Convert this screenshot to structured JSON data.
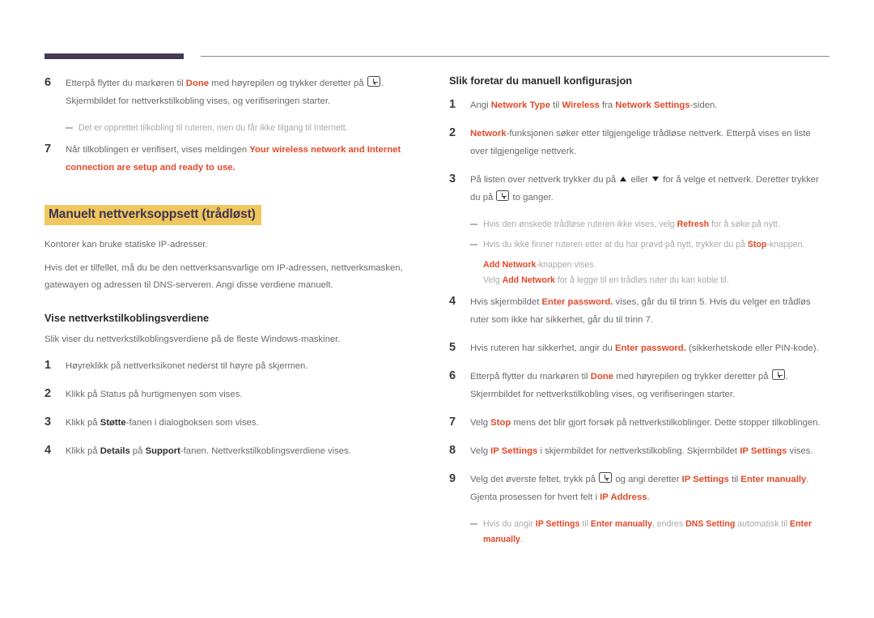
{
  "colors": {
    "accent_red": "#e2492a",
    "highlight_yellow": "#efc75e",
    "heading_purple": "#3f3354",
    "rule_purple": "#453a55",
    "body_gray": "#6a6a6a",
    "note_gray": "#a9a9a9"
  },
  "left_column": {
    "step6": {
      "num": "6",
      "t1": "Etterpå flytter du markøren til ",
      "a1": "Done",
      "t2": " med høyrepilen og trykker deretter på ",
      "t3": ". Skjermbildet for nettverkstilkobling vises, og verifiseringen starter."
    },
    "note6": "Det er opprettet tilkobling til ruteren, men du får ikke tilgang til Internett.",
    "step7": {
      "num": "7",
      "t1": "Når tilkoblingen er verifisert, vises meldingen ",
      "a1": "Your wireless network and Internet connection are setup and ready to use."
    },
    "heading_manual": "Manuelt nettverksoppsett (trådløst)",
    "para1": "Kontorer kan bruke statiske IP-adresser.",
    "para2": "Hvis det er tilfellet, må du be den nettverksansvarlige om IP-adressen, nettverksmasken, gatewayen og adressen til DNS-serveren. Angi disse verdiene manuelt.",
    "heading_view": "Vise nettverkstilkoblingsverdiene",
    "para3": "Slik viser du nettverkstilkoblingsverdiene på de fleste Windows-maskiner.",
    "steps": [
      {
        "num": "1",
        "t1": "Høyreklikk på nettverksikonet nederst til høyre på skjermen."
      },
      {
        "num": "2",
        "t1": "Klikk på Status på hurtigmenyen som vises."
      },
      {
        "num": "3",
        "t1": "Klikk på ",
        "b1": "Støtte",
        "t2": "-fanen i dialogboksen som vises."
      },
      {
        "num": "4",
        "t1": "Klikk på ",
        "b1": "Details",
        "t2": " på ",
        "b2": "Support",
        "t3": "-fanen. Nettverkstilkoblingsverdiene vises."
      }
    ]
  },
  "right_column": {
    "heading": "Slik foretar du manuell konfigurasjon",
    "step1": {
      "num": "1",
      "t1": "Angi ",
      "a1": "Network Type",
      "t2": " til ",
      "a2": "Wireless",
      "t3": " fra ",
      "a3": "Network Settings",
      "t4": "-siden."
    },
    "step2": {
      "num": "2",
      "a1": "Network",
      "t1": "-funksjonen søker etter tilgjengelige trådløse nettverk. Etterpå vises en liste over tilgjengelige nettverk."
    },
    "step3": {
      "num": "3",
      "t1": "På listen over nettverk trykker du på ",
      "t2": " eller ",
      "t3": " for å velge et nettverk. Deretter trykker du på ",
      "t4": " to ganger."
    },
    "note3a": {
      "t1": "Hvis den ønskede trådløse ruteren ikke vises, velg ",
      "a1": "Refresh",
      "t2": " for å søke på nytt."
    },
    "note3b": {
      "t1": "Hvis du ikke finner ruteren etter at du har prøvd på nytt, trykker du på ",
      "a1": "Stop",
      "t2": "-knappen.",
      "a2": "Add Network",
      "t3": "-knappen vises.",
      "t4": "Velg ",
      "a3": "Add Network",
      "t5": " for å legge til en trådløs ruter du kan koble til."
    },
    "step4": {
      "num": "4",
      "t1": "Hvis skjermbildet ",
      "a1": "Enter password.",
      "t2": " vises, går du til trinn 5. Hvis du velger en trådløs ruter som ikke har sikkerhet, går du til trinn 7."
    },
    "step5": {
      "num": "5",
      "t1": "Hvis ruteren har sikkerhet, angir du ",
      "a1": "Enter password.",
      "t2": " (sikkerhetskode eller PIN-kode)."
    },
    "step6": {
      "num": "6",
      "t1": "Etterpå flytter du markøren til ",
      "a1": "Done",
      "t2": " med høyrepilen og trykker deretter på ",
      "t3": ". Skjermbildet for nettverkstilkobling vises, og verifiseringen starter."
    },
    "step7": {
      "num": "7",
      "t1": "Velg ",
      "a1": "Stop",
      "t2": " mens det blir gjort forsøk på nettverkstilkoblinger. Dette stopper tilkoblingen."
    },
    "step8": {
      "num": "8",
      "t1": "Velg ",
      "a1": "IP Settings",
      "t2": " i skjermbildet for nettverkstilkobling. Skjermbildet ",
      "a2": "IP Settings",
      "t3": " vises."
    },
    "step9": {
      "num": "9",
      "t1": "Velg det øverste feltet, trykk på ",
      "t2": " og angi deretter ",
      "a1": "IP Settings",
      "t3": " til ",
      "a2": "Enter manually",
      "t4": ". Gjenta prosessen for hvert felt i ",
      "a3": "IP Address",
      "t5": "."
    },
    "note9": {
      "t1": "Hvis du angir ",
      "a1": "IP Settings",
      "t2": " til ",
      "a2": "Enter manually",
      "t3": ", endres ",
      "a3": "DNS Setting",
      "t4": " automatisk til ",
      "a4": "Enter manually",
      "t5": "."
    }
  }
}
